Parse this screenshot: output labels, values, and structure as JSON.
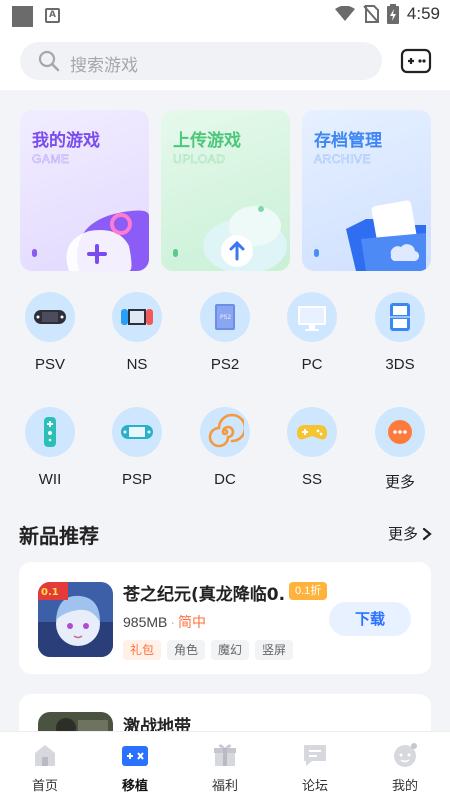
{
  "status_bar": {
    "time": "4:59",
    "notification_letter": "A"
  },
  "search": {
    "placeholder": "搜索游戏"
  },
  "feature_cards": [
    {
      "title": "我的游戏",
      "subtitle": "GAME",
      "color": "#7a4cf0"
    },
    {
      "title": "上传游戏",
      "subtitle": "UPLOAD",
      "color": "#4cc77a"
    },
    {
      "title": "存档管理",
      "subtitle": "ARCHIVE",
      "color": "#3f86f5"
    }
  ],
  "platforms": [
    {
      "label": "PSV",
      "icon": "psv-handheld-icon"
    },
    {
      "label": "NS",
      "icon": "switch-console-icon"
    },
    {
      "label": "PS2",
      "icon": "ps2-console-icon"
    },
    {
      "label": "PC",
      "icon": "monitor-icon"
    },
    {
      "label": "3DS",
      "icon": "3ds-handheld-icon"
    },
    {
      "label": "WII",
      "icon": "wii-remote-icon"
    },
    {
      "label": "PSP",
      "icon": "psp-handheld-icon"
    },
    {
      "label": "DC",
      "icon": "dreamcast-swirl-icon"
    },
    {
      "label": "SS",
      "icon": "saturn-controller-icon"
    },
    {
      "label": "更多",
      "icon": "more-dots-icon"
    }
  ],
  "section": {
    "title": "新品推荐",
    "more": "更多"
  },
  "games": [
    {
      "name": "苍之纪元(真龙降临0.",
      "badge": "0.1折",
      "size": "985MB",
      "language": "简中",
      "tags": [
        "礼包",
        "角色",
        "魔幻",
        "竖屏"
      ],
      "action": "下载"
    },
    {
      "name": "激战地带"
    }
  ],
  "tabs": [
    {
      "label": "首页",
      "icon": "home-icon"
    },
    {
      "label": "移植",
      "icon": "port-gamepad-icon",
      "active": true
    },
    {
      "label": "福利",
      "icon": "gift-icon"
    },
    {
      "label": "论坛",
      "icon": "forum-icon"
    },
    {
      "label": "我的",
      "icon": "profile-face-icon"
    }
  ],
  "colors": {
    "accent": "#2a71ff",
    "discount": "#ffb33d",
    "tag_highlight": "#ff6f3c",
    "platform_bg": "#cfe6ff"
  }
}
